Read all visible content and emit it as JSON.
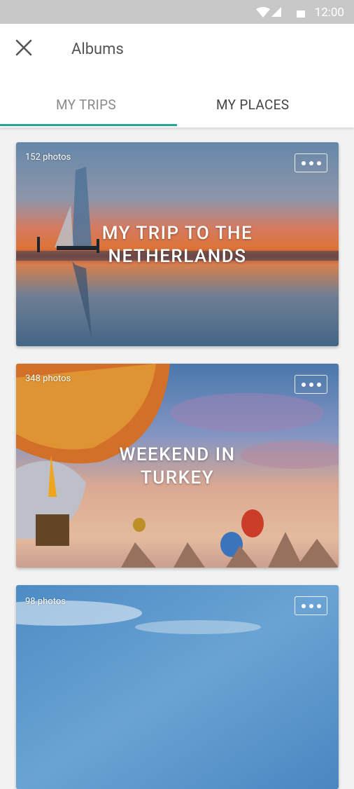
{
  "status_bar": {
    "time": "12:00",
    "icons": [
      "wifi-icon",
      "cell-signal-icon",
      "battery-icon"
    ]
  },
  "header": {
    "title": "Albums"
  },
  "tabs": [
    {
      "label": "MY TRIPS",
      "selected": true
    },
    {
      "label": "MY PLACES",
      "selected": false
    }
  ],
  "albums": [
    {
      "count": "152 photos",
      "name_line1": "MY TRIP TO THE",
      "name_line2": "NETHERLANDS"
    },
    {
      "count": "348 photos",
      "name_line1": "WEEKEND IN",
      "name_line2": "TURKEY"
    },
    {
      "count": "98 photos"
    }
  ],
  "colors": {
    "accent": "#26a69a"
  }
}
